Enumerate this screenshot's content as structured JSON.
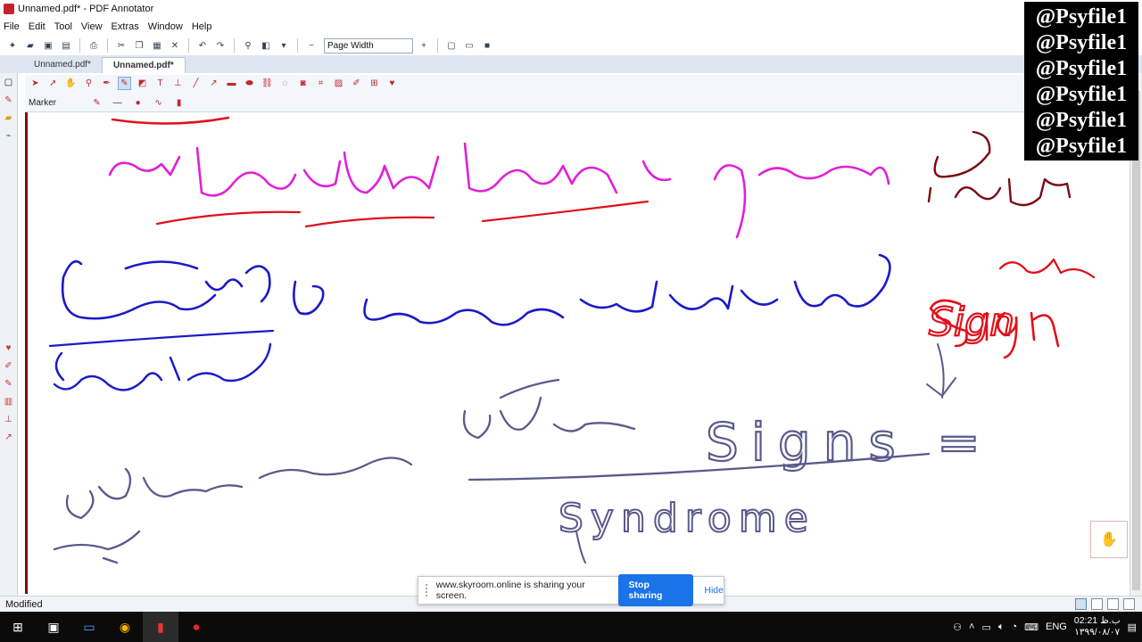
{
  "window": {
    "title": "Unnamed.pdf* - PDF Annotator"
  },
  "menu": [
    "File",
    "Edit",
    "Tool",
    "View",
    "Extras",
    "Window",
    "Help"
  ],
  "toolbar": {
    "zoom_value": "Page Width"
  },
  "tabs": [
    {
      "label": "Unnamed.pdf*",
      "active": false
    },
    {
      "label": "Unnamed.pdf*",
      "active": true
    }
  ],
  "annotation_toolbar": {
    "current_tool_label": "Marker"
  },
  "watermark": {
    "lines": [
      "@Psyfile1",
      "@Psyfile1",
      "@Psyfile1",
      "@Psyfile1",
      "@Psyfile1",
      "@Psyfile1"
    ]
  },
  "handwriting": {
    "sign_word": "Sign",
    "signs_word": "Signs =",
    "syndrome_word": "Syndrome"
  },
  "status": {
    "text": "Modified"
  },
  "share_bar": {
    "message": "www.skyroom.online is sharing your screen.",
    "stop_label": "Stop sharing",
    "hide_label": "Hide"
  },
  "taskbar": {
    "lang": "ENG",
    "time": "02:21 ب.ظ",
    "date": "۱۳۹۹/۰۸/۰۷"
  },
  "colors": {
    "pink_ink": "#e020d8",
    "red_ink": "#e0101a",
    "blue_ink": "#1a1ac8",
    "maroon_ink": "#7a0a12",
    "slate_ink": "#5a5a8c",
    "accent": "#1a73e8"
  }
}
